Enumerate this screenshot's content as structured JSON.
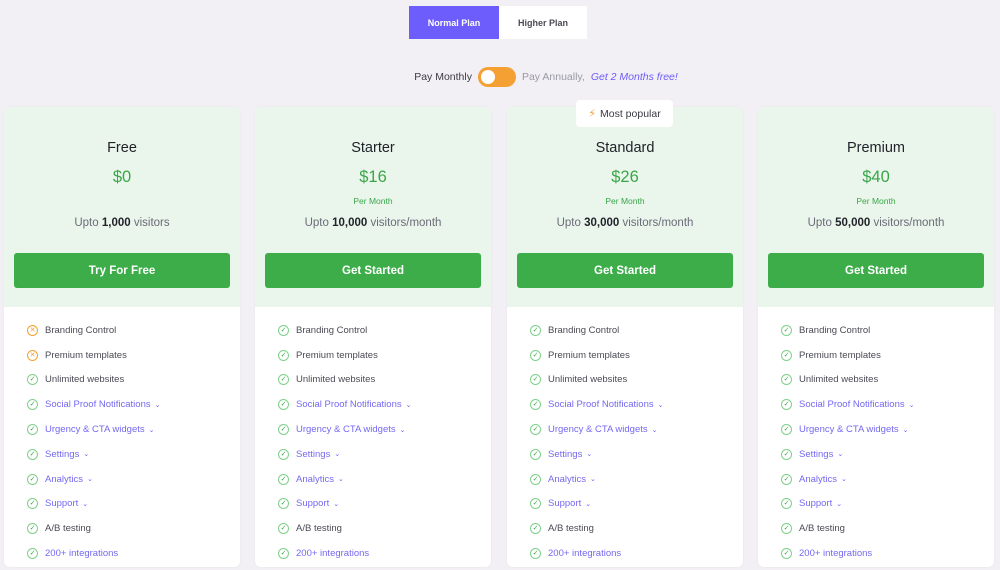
{
  "tabs": [
    {
      "label": "Normal Plan",
      "active": true
    },
    {
      "label": "Higher Plan",
      "active": false
    }
  ],
  "billing": {
    "monthly_label": "Pay Monthly",
    "annually_label": "Pay Annually,",
    "promo": "Get 2 Months free!",
    "toggle_state": "monthly"
  },
  "colors": {
    "accent": "#6c5dfc",
    "green": "#3cad49",
    "orange": "#f4a033",
    "card_head_bg": "#eaf6ec"
  },
  "badge": {
    "icon": "lightning-icon",
    "label": "Most popular"
  },
  "plans": [
    {
      "name": "Free",
      "price": "$0",
      "per": "",
      "visitors_prefix": "Upto",
      "visitors_count": "1,000",
      "visitors_suffix": "visitors",
      "cta": "Try For Free",
      "features": [
        {
          "label": "Branding Control",
          "included": false,
          "expandable": false
        },
        {
          "label": "Premium templates",
          "included": false,
          "expandable": false
        },
        {
          "label": "Unlimited websites",
          "included": true,
          "expandable": false
        },
        {
          "label": "Social Proof Notifications",
          "included": true,
          "expandable": true
        },
        {
          "label": "Urgency & CTA widgets",
          "included": true,
          "expandable": true
        },
        {
          "label": "Settings",
          "included": true,
          "expandable": true
        },
        {
          "label": "Analytics",
          "included": true,
          "expandable": true
        },
        {
          "label": "Support",
          "included": true,
          "expandable": true
        },
        {
          "label": "A/B testing",
          "included": true,
          "expandable": false
        },
        {
          "label": "200+ integrations",
          "included": true,
          "expandable": false,
          "link": true
        }
      ]
    },
    {
      "name": "Starter",
      "price": "$16",
      "per": "Per Month",
      "visitors_prefix": "Upto",
      "visitors_count": "10,000",
      "visitors_suffix": "visitors/month",
      "cta": "Get Started",
      "features": [
        {
          "label": "Branding Control",
          "included": true,
          "expandable": false
        },
        {
          "label": "Premium templates",
          "included": true,
          "expandable": false
        },
        {
          "label": "Unlimited websites",
          "included": true,
          "expandable": false
        },
        {
          "label": "Social Proof Notifications",
          "included": true,
          "expandable": true
        },
        {
          "label": "Urgency & CTA widgets",
          "included": true,
          "expandable": true
        },
        {
          "label": "Settings",
          "included": true,
          "expandable": true
        },
        {
          "label": "Analytics",
          "included": true,
          "expandable": true
        },
        {
          "label": "Support",
          "included": true,
          "expandable": true
        },
        {
          "label": "A/B testing",
          "included": true,
          "expandable": false
        },
        {
          "label": "200+ integrations",
          "included": true,
          "expandable": false,
          "link": true
        }
      ]
    },
    {
      "name": "Standard",
      "price": "$26",
      "per": "Per Month",
      "visitors_prefix": "Upto",
      "visitors_count": "30,000",
      "visitors_suffix": "visitors/month",
      "cta": "Get Started",
      "popular": true,
      "features": [
        {
          "label": "Branding Control",
          "included": true,
          "expandable": false
        },
        {
          "label": "Premium templates",
          "included": true,
          "expandable": false
        },
        {
          "label": "Unlimited websites",
          "included": true,
          "expandable": false
        },
        {
          "label": "Social Proof Notifications",
          "included": true,
          "expandable": true
        },
        {
          "label": "Urgency & CTA widgets",
          "included": true,
          "expandable": true
        },
        {
          "label": "Settings",
          "included": true,
          "expandable": true
        },
        {
          "label": "Analytics",
          "included": true,
          "expandable": true
        },
        {
          "label": "Support",
          "included": true,
          "expandable": true
        },
        {
          "label": "A/B testing",
          "included": true,
          "expandable": false
        },
        {
          "label": "200+ integrations",
          "included": true,
          "expandable": false,
          "link": true
        }
      ]
    },
    {
      "name": "Premium",
      "price": "$40",
      "per": "Per Month",
      "visitors_prefix": "Upto",
      "visitors_count": "50,000",
      "visitors_suffix": "visitors/month",
      "cta": "Get Started",
      "features": [
        {
          "label": "Branding Control",
          "included": true,
          "expandable": false
        },
        {
          "label": "Premium templates",
          "included": true,
          "expandable": false
        },
        {
          "label": "Unlimited websites",
          "included": true,
          "expandable": false
        },
        {
          "label": "Social Proof Notifications",
          "included": true,
          "expandable": true
        },
        {
          "label": "Urgency & CTA widgets",
          "included": true,
          "expandable": true
        },
        {
          "label": "Settings",
          "included": true,
          "expandable": true
        },
        {
          "label": "Analytics",
          "included": true,
          "expandable": true
        },
        {
          "label": "Support",
          "included": true,
          "expandable": true
        },
        {
          "label": "A/B testing",
          "included": true,
          "expandable": false
        },
        {
          "label": "200+ integrations",
          "included": true,
          "expandable": false,
          "link": true
        }
      ]
    }
  ]
}
